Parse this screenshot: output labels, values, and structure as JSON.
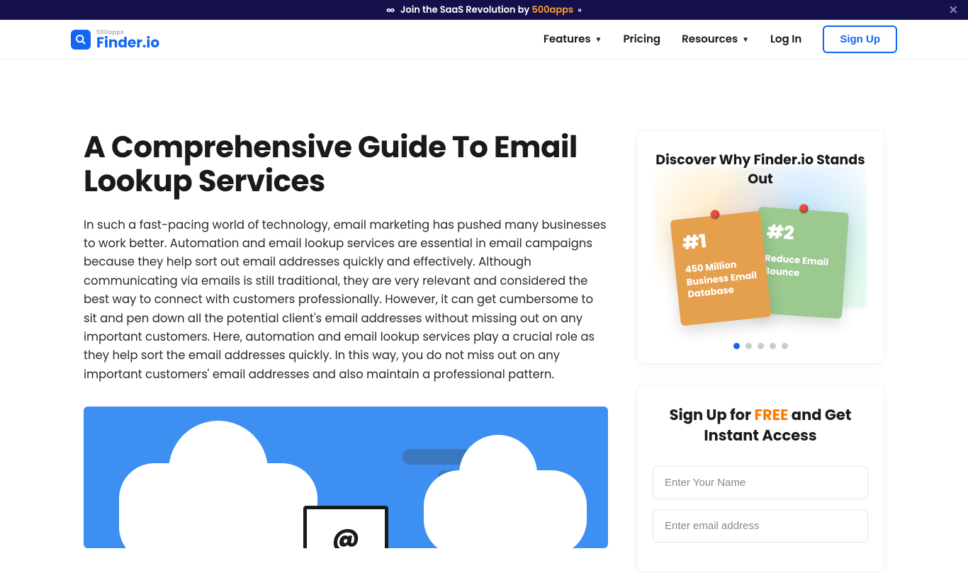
{
  "topbar": {
    "prefix": "Join the SaaS Revolution by ",
    "highlight": "500apps"
  },
  "logo": {
    "sub": "500apps",
    "main": "Finder.io"
  },
  "nav": {
    "features": "Features",
    "pricing": "Pricing",
    "resources": "Resources",
    "login": "Log In",
    "signup": "Sign Up"
  },
  "article": {
    "title": "A Comprehensive Guide To Email Lookup Services",
    "body": "In such a fast-pacing world of technology, email marketing has pushed many businesses to work better. Automation and email lookup services are essential in email campaigns because they help sort out email addresses quickly and effectively. Although communicating via emails is still traditional, they are very relevant and considered the best way to connect with customers professionally. However, it can get cumbersome to sit and pen down all the potential client's email addresses without missing out on any important customers. Here, automation and email lookup services play a crucial role as they help sort the email addresses quickly. In this way, you do not miss out on any important customers' email addresses and also maintain a professional pattern."
  },
  "discover": {
    "title": "Discover Why Finder.io Stands Out",
    "notes": [
      {
        "num": "#1",
        "text": "450 Million Business Email Database"
      },
      {
        "num": "#2",
        "text": "Reduce Email Bounce"
      }
    ]
  },
  "signup": {
    "prefix": "Sign Up for ",
    "free": "FREE",
    "suffix": " and Get Instant Access",
    "name_ph": "Enter Your Name",
    "email_ph": "Enter email address"
  }
}
